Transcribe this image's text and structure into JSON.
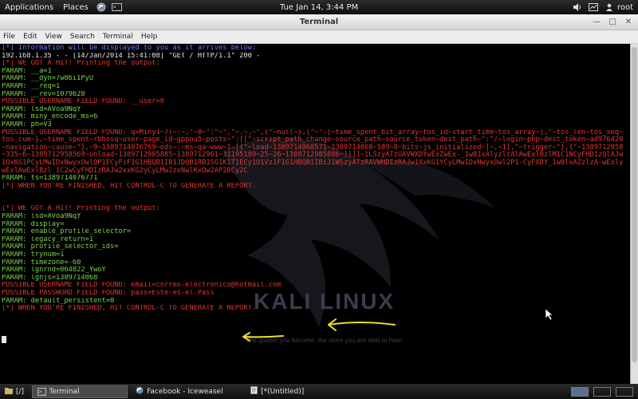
{
  "top_panel": {
    "applications": "Applications",
    "places": "Places",
    "clock": "Tue Jan 14,  3:44 PM",
    "user": "root"
  },
  "window": {
    "title": "Terminal",
    "menu": [
      "File",
      "Edit",
      "View",
      "Search",
      "Terminal",
      "Help"
    ]
  },
  "watermark": {
    "brand": "KALI LINUX",
    "tagline": "The quieter you become, the more you are able to hear."
  },
  "terminal": {
    "lines": [
      {
        "color": "blue",
        "text": "[*] Information will be displayed to you as it arrives below:"
      },
      {
        "color": "white",
        "text": "192.168.1.35 - - [14/Jan/2014 15:41:08] \"GET / HTTP/1.1\" 200 -"
      },
      {
        "color": "red",
        "text": "[*] WE GOT A HIT! Printing the output:"
      },
      {
        "color": "green",
        "text": "PARAM: __a=1"
      },
      {
        "color": "green",
        "text": "PARAM: __dyn=7w86i1PyU"
      },
      {
        "color": "green",
        "text": "PARAM: __req=1"
      },
      {
        "color": "green",
        "text": "PARAM: __rev=1079628"
      },
      {
        "color": "red",
        "text": "POSSIBLE USERNAME FIELD FOUND: __user=0"
      },
      {
        "color": "green",
        "text": "PARAM: lsd=AVoa9NqY"
      },
      {
        "color": "green",
        "text": "PARAM: miny_encode_ms=6"
      },
      {
        "color": "green",
        "text": "PARAM: ph=V3"
      },
      {
        "color": "red",
        "wrap": true,
        "text": "POSSIBLE USERNAME FIELD FOUND: q=Miny1~7l~:~,\"~0~\":\"~\",\"~.~,~\",{\"~null~},[\"~\":[~time_spent_bit_array~tos_id~start_time~tos_array~],\"~tos_len~tos_seq~tos_cum~},~time_spent~rbhosq~user~page_id~gppnu5~posts~\":[[\"~script_path_change~source_path~source_token~dest_path~\":\"/~login~php~dest_token~ad976420~navigation~cause~\"},~9~1389714076769~ods~:~ms~qa~www~1~[{\"~load~1389714068571~1389714068~589~8~bits~js_initialized~]~,~1],\"~trigger~\"},{\"~1389712958~335~6~1389712958569~unload~1389712985885~1389712961~31195109~25~26~1389712985886~]}]]~1LSzyATzUAVWXDYwExZwEx-_1wB1xAlyzlzAlAwExlBzlM1C1NCyFHD1zQlAJw1OxKG1PCyLMwIDxNwyxOwlQP1ECyFiF1G1HBQB1IB1JDQB1RB1SG1K1T1ECy1U1Vz1F1G1HBQB1IBiJ1WSzyATzRAVWHDIzRAJw1XxKG1YCyLMwIDxNwyxOwl2P1-CyFXDY_1wBlxAZzlzA-wExlywExlAwExlBzl_1C2wCyFHDIzRAJw2xxKG2yCyLMw2zxNwlKxOw2AP2BCy2C"
      },
      {
        "color": "green",
        "text": "PARAM: ts=1389714076771"
      },
      {
        "color": "red",
        "text": "[*] WHEN YOU'RE FINISHED, HIT CONTROL-C TO GENERATE A REPORT."
      },
      {
        "color": "white",
        "text": ""
      },
      {
        "color": "white",
        "text": ""
      },
      {
        "color": "red",
        "text": "[*] WE GOT A HIT! Printing the output:"
      },
      {
        "color": "green",
        "text": "PARAM: lsd=AVoa9NqY"
      },
      {
        "color": "green",
        "text": "PARAM: display="
      },
      {
        "color": "green",
        "text": "PARAM: enable_profile_selector="
      },
      {
        "color": "green",
        "text": "PARAM: legacy_return=1"
      },
      {
        "color": "green",
        "text": "PARAM: profile_selector_ids="
      },
      {
        "color": "green",
        "text": "PARAM: trynum=1"
      },
      {
        "color": "green",
        "text": "PARAM: timezone=-60"
      },
      {
        "color": "green",
        "text": "PARAM: lgnrnd=064022_YwoY"
      },
      {
        "color": "green",
        "text": "PARAM: lgnjs=1389714068"
      },
      {
        "color": "red",
        "text": "POSSIBLE USERNAME FIELD FOUND: email=correo-electronico@hotmail.com"
      },
      {
        "color": "red",
        "text": "POSSIBLE PASSWORD FIELD FOUND: pass=Este-es-el-Pass"
      },
      {
        "color": "green",
        "text": "PARAM: default_persistent=0"
      },
      {
        "color": "red",
        "text": "[*] WHEN YOU'RE FINISHED, HIT CONTROL-C TO GENERATE A REPORT."
      },
      {
        "color": "white",
        "text": ""
      },
      {
        "color": "white",
        "text": ""
      },
      {
        "color": "white",
        "text": ""
      }
    ]
  },
  "taskbar": {
    "tasks": [
      {
        "label": "[/]",
        "icon": "folder-icon"
      },
      {
        "label": "Terminal",
        "icon": "terminal-icon",
        "active": true
      },
      {
        "label": "Facebook - Iceweasel",
        "icon": "browser-icon"
      },
      {
        "label": "*(Untitled)]",
        "prefix": "[",
        "icon": "text-editor-icon"
      }
    ]
  },
  "colors": {
    "blue": "#6a74ff",
    "red": "#e5352f",
    "green": "#7fd34a",
    "white": "#e6e6e6",
    "arrow": "#f0e020"
  }
}
